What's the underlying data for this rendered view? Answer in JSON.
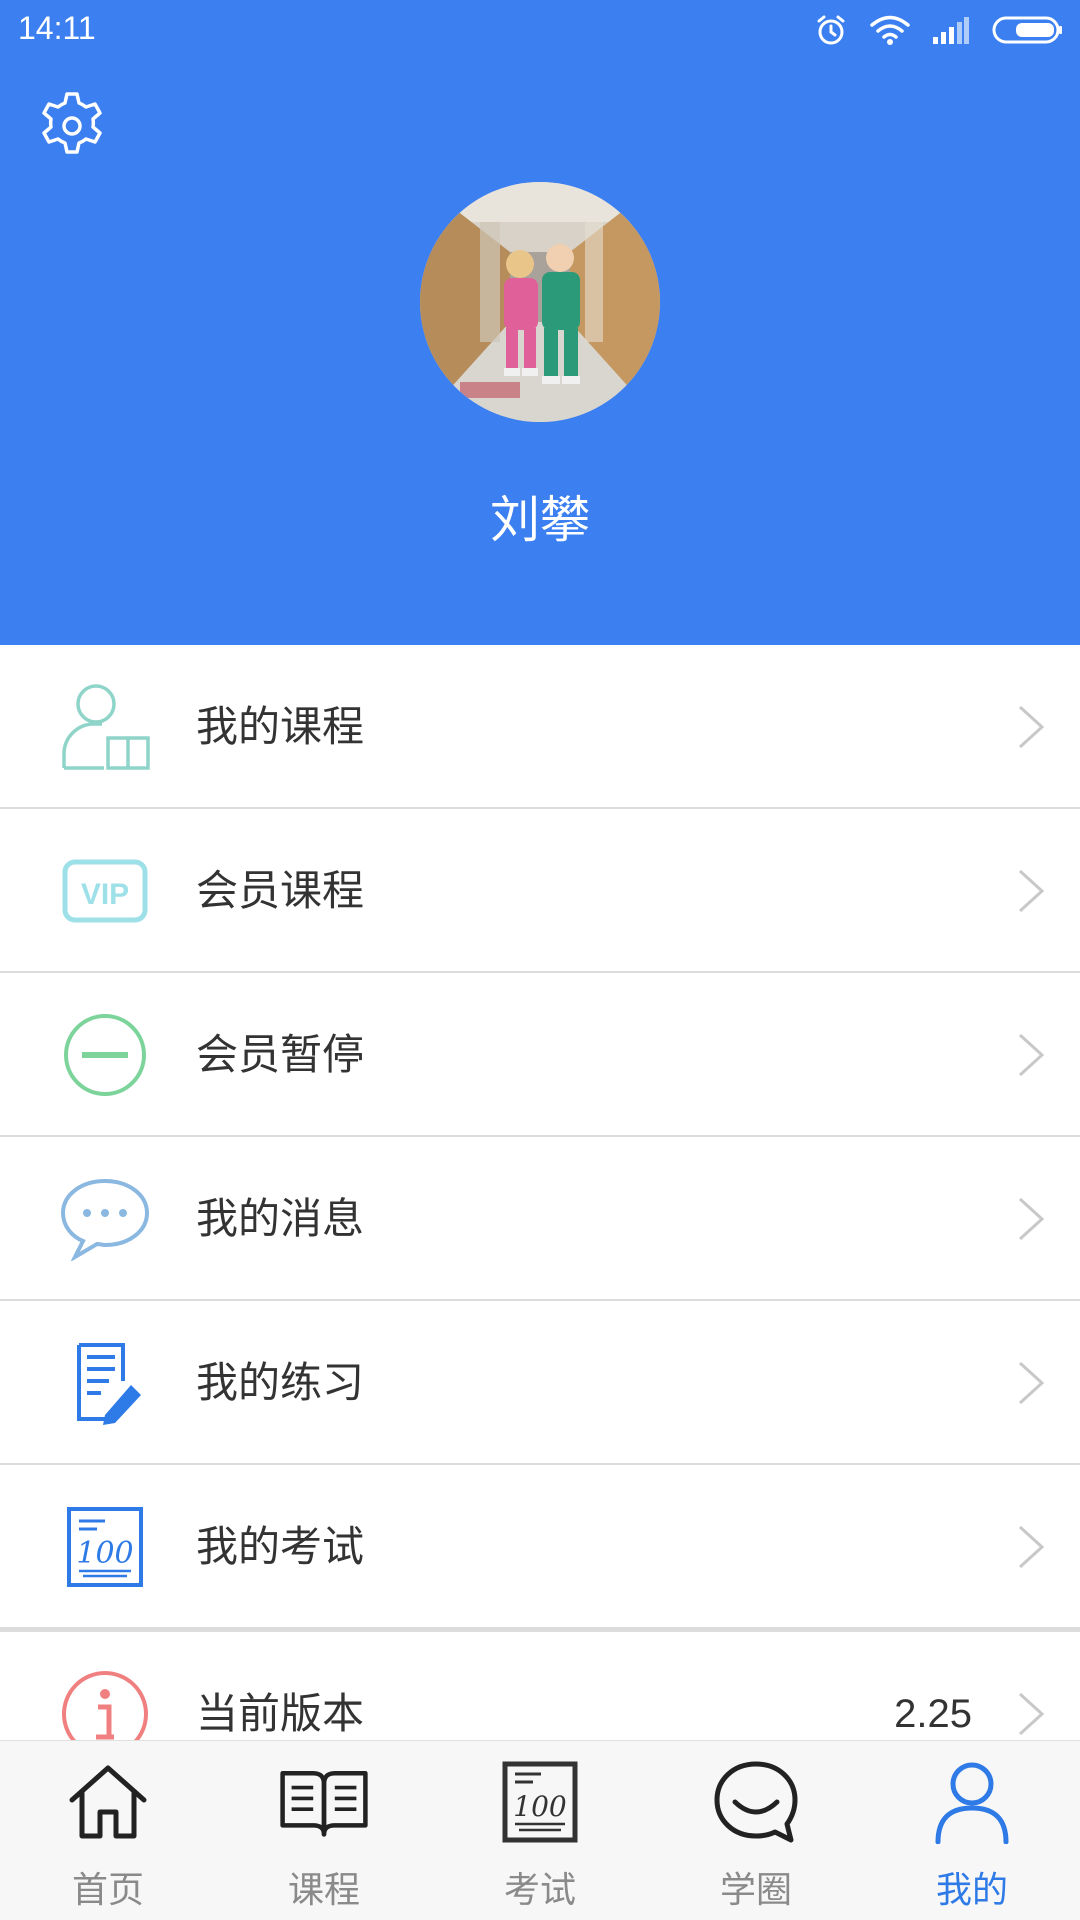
{
  "status_bar": {
    "time": "14:11"
  },
  "profile": {
    "name": "刘攀"
  },
  "menu": [
    {
      "id": "my-courses",
      "label": "我的课程",
      "icon": "user-book-icon",
      "value": ""
    },
    {
      "id": "member-courses",
      "label": "会员课程",
      "icon": "vip-icon",
      "value": ""
    },
    {
      "id": "member-pause",
      "label": "会员暂停",
      "icon": "minus-circle-icon",
      "value": ""
    },
    {
      "id": "my-messages",
      "label": "我的消息",
      "icon": "chat-bubble-icon",
      "value": ""
    },
    {
      "id": "my-practice",
      "label": "我的练习",
      "icon": "document-edit-icon",
      "value": ""
    },
    {
      "id": "my-exams",
      "label": "我的考试",
      "icon": "score-100-icon",
      "value": ""
    },
    {
      "id": "current-version",
      "label": "当前版本",
      "icon": "info-icon",
      "value": "2.25"
    }
  ],
  "bottom_nav": [
    {
      "label": "首页",
      "icon": "home-icon",
      "active": false
    },
    {
      "label": "课程",
      "icon": "book-icon",
      "active": false
    },
    {
      "label": "考试",
      "icon": "exam-icon",
      "active": false
    },
    {
      "label": "学圈",
      "icon": "chat-circle-icon",
      "active": false
    },
    {
      "label": "我的",
      "icon": "person-icon",
      "active": true
    }
  ],
  "colors": {
    "header": "#3b7ff0",
    "active_nav": "#2e7ae6",
    "inactive_nav": "#8a8a8a"
  }
}
